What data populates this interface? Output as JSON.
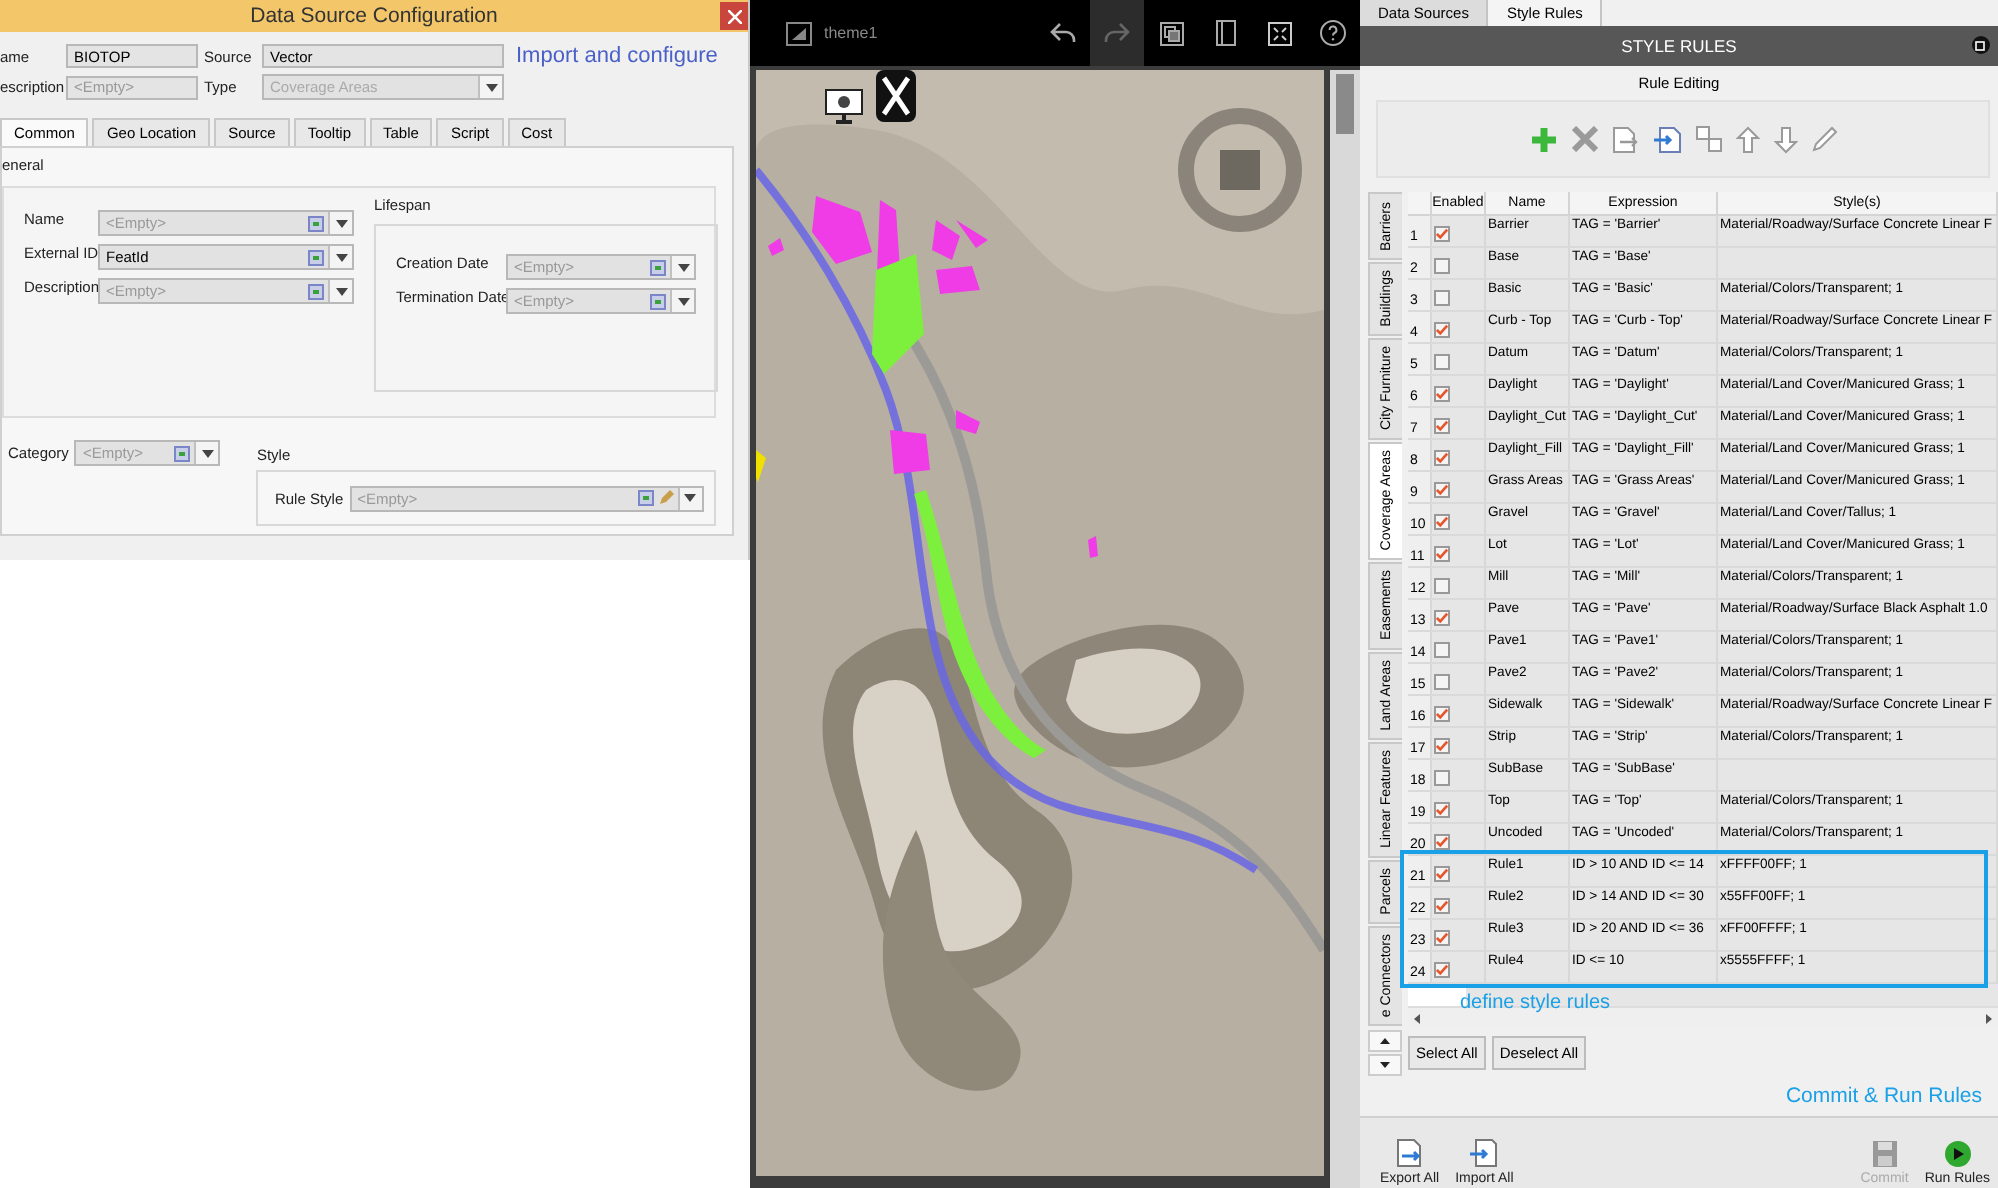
{
  "dialog": {
    "title": "Data Source Configuration",
    "note": "Import and configure",
    "fields": [
      {
        "label": "ame",
        "kind": "text",
        "value": "BIOTOP",
        "disabled": false
      },
      {
        "label": "Source",
        "kind": "text",
        "value": "Vector",
        "disabled": false
      },
      {
        "label": "escription",
        "kind": "text",
        "placeholder": "<Empty>",
        "disabled": false
      },
      {
        "label": "Type",
        "kind": "combo",
        "value": "Coverage Areas",
        "disabled": true
      }
    ],
    "tabs": [
      {
        "label": "Common",
        "selected": true
      },
      {
        "label": "Geo Location",
        "selected": false
      },
      {
        "label": "Source",
        "selected": false
      },
      {
        "label": "Tooltip",
        "selected": false
      },
      {
        "label": "Table",
        "selected": false
      },
      {
        "label": "Script",
        "selected": false
      },
      {
        "label": "Cost",
        "selected": false
      }
    ],
    "general": {
      "title": "eneral",
      "fields": [
        {
          "label": "Name",
          "placeholder": "<Empty>"
        },
        {
          "label": "External ID",
          "value": "FeatId"
        },
        {
          "label": "Description",
          "placeholder": "<Empty>"
        }
      ]
    },
    "lifespan": {
      "title": "Lifespan",
      "fields": [
        {
          "label": "Creation Date",
          "placeholder": "<Empty>"
        },
        {
          "label": "Termination Date",
          "placeholder": "<Empty>"
        }
      ]
    },
    "category": {
      "label": "Category",
      "placeholder": "<Empty>"
    },
    "style": {
      "title": "Style",
      "label": "Rule Style",
      "placeholder": "<Empty>"
    }
  },
  "viewer": {
    "theme": "theme1",
    "buttons": [
      {
        "kind": "undo",
        "highlighted": false
      },
      {
        "kind": "redo",
        "highlighted": true
      },
      {
        "kind": "layers",
        "highlighted": false
      },
      {
        "kind": "book",
        "highlighted": false
      },
      {
        "kind": "fullscreen",
        "highlighted": false
      },
      {
        "kind": "help",
        "highlighted": false
      }
    ]
  },
  "panel": {
    "tabs": [
      {
        "label": "Data Sources",
        "selected": false
      },
      {
        "label": "Style Rules",
        "selected": true
      }
    ],
    "header": "STYLE RULES",
    "group": "Rule Editing",
    "side_tabs": [
      {
        "label": "Barriers",
        "selected": false
      },
      {
        "label": "Buildings",
        "selected": false
      },
      {
        "label": "City Furniture",
        "selected": false
      },
      {
        "label": "Coverage Areas",
        "selected": true
      },
      {
        "label": "Easements",
        "selected": false
      },
      {
        "label": "Land Areas",
        "selected": false
      },
      {
        "label": "Linear Features",
        "selected": false
      },
      {
        "label": "Parcels",
        "selected": false
      },
      {
        "label": "e Connectors",
        "selected": false
      }
    ],
    "table": {
      "columns": [
        "Enabled",
        "Name",
        "Expression",
        "Style(s)"
      ],
      "rows": [
        {
          "num": "1",
          "enabled": true,
          "name": "Barrier",
          "expression": "TAG = 'Barrier'",
          "style": "Material/Roadway/Surface Concrete Linear F"
        },
        {
          "num": "2",
          "enabled": false,
          "name": "Base",
          "expression": "TAG = 'Base'"
        },
        {
          "num": "3",
          "enabled": false,
          "name": "Basic",
          "expression": "TAG = 'Basic'",
          "style": "Material/Colors/Transparent; 1"
        },
        {
          "num": "4",
          "enabled": true,
          "name": "Curb - Top",
          "expression": "TAG = 'Curb - Top'",
          "style": "Material/Roadway/Surface Concrete Linear F"
        },
        {
          "num": "5",
          "enabled": false,
          "name": "Datum",
          "expression": "TAG = 'Datum'",
          "style": "Material/Colors/Transparent; 1"
        },
        {
          "num": "6",
          "enabled": true,
          "name": "Daylight",
          "expression": "TAG = 'Daylight'",
          "style": "Material/Land Cover/Manicured Grass; 1"
        },
        {
          "num": "7",
          "enabled": true,
          "name": "Daylight_Cut",
          "expression": "TAG = 'Daylight_Cut'",
          "style": "Material/Land Cover/Manicured Grass; 1"
        },
        {
          "num": "8",
          "enabled": true,
          "name": "Daylight_Fill",
          "expression": "TAG = 'Daylight_Fill'",
          "style": "Material/Land Cover/Manicured Grass; 1"
        },
        {
          "num": "9",
          "enabled": true,
          "name": "Grass Areas",
          "expression": "TAG = 'Grass Areas'",
          "style": "Material/Land Cover/Manicured Grass; 1"
        },
        {
          "num": "10",
          "enabled": true,
          "name": "Gravel",
          "expression": "TAG = 'Gravel'",
          "style": "Material/Land Cover/Tallus; 1"
        },
        {
          "num": "11",
          "enabled": true,
          "name": "Lot",
          "expression": "TAG = 'Lot'",
          "style": "Material/Land Cover/Manicured Grass; 1"
        },
        {
          "num": "12",
          "enabled": false,
          "name": "Mill",
          "expression": "TAG = 'Mill'",
          "style": "Material/Colors/Transparent; 1"
        },
        {
          "num": "13",
          "enabled": true,
          "name": "Pave",
          "expression": "TAG = 'Pave'",
          "style": "Material/Roadway/Surface Black Asphalt 1.0"
        },
        {
          "num": "14",
          "enabled": false,
          "name": "Pave1",
          "expression": "TAG = 'Pave1'",
          "style": "Material/Colors/Transparent; 1"
        },
        {
          "num": "15",
          "enabled": false,
          "name": "Pave2",
          "expression": "TAG = 'Pave2'",
          "style": "Material/Colors/Transparent; 1"
        },
        {
          "num": "16",
          "enabled": true,
          "name": "Sidewalk",
          "expression": "TAG = 'Sidewalk'",
          "style": "Material/Roadway/Surface Concrete Linear F"
        },
        {
          "num": "17",
          "enabled": true,
          "name": "Strip",
          "expression": "TAG = 'Strip'",
          "style": "Material/Colors/Transparent; 1"
        },
        {
          "num": "18",
          "enabled": false,
          "name": "SubBase",
          "expression": "TAG = 'SubBase'"
        },
        {
          "num": "19",
          "enabled": true,
          "name": "Top",
          "expression": "TAG = 'Top'",
          "style": "Material/Colors/Transparent; 1"
        },
        {
          "num": "20",
          "enabled": true,
          "name": "Uncoded",
          "expression": "TAG = 'Uncoded'",
          "style": "Material/Colors/Transparent; 1"
        },
        {
          "num": "21",
          "enabled": true,
          "name": "Rule1",
          "expression": "ID > 10 AND ID <= 14",
          "style": "xFFFF00FF; 1"
        },
        {
          "num": "22",
          "enabled": true,
          "name": "Rule2",
          "expression": "ID > 14 AND ID <= 30",
          "style": "x55FF00FF; 1"
        },
        {
          "num": "23",
          "enabled": true,
          "name": "Rule3",
          "expression": "ID > 20 AND ID <= 36",
          "style": "xFF00FFFF; 1"
        },
        {
          "num": "24",
          "enabled": true,
          "name": "Rule4",
          "expression": "ID <= 10",
          "style": "x5555FFFF; 1"
        }
      ]
    },
    "annotation": "define style rules",
    "select_buttons": [
      "Select All",
      "Deselect All"
    ],
    "commit_note": "Commit & Run Rules",
    "actions": [
      {
        "label": "Export All",
        "kind": "export",
        "disabled": false
      },
      {
        "label": "Import All",
        "kind": "import",
        "disabled": false
      },
      {
        "label": "Commit",
        "kind": "commit",
        "disabled": true
      },
      {
        "label": "Run Rules",
        "kind": "run",
        "disabled": false
      }
    ]
  }
}
